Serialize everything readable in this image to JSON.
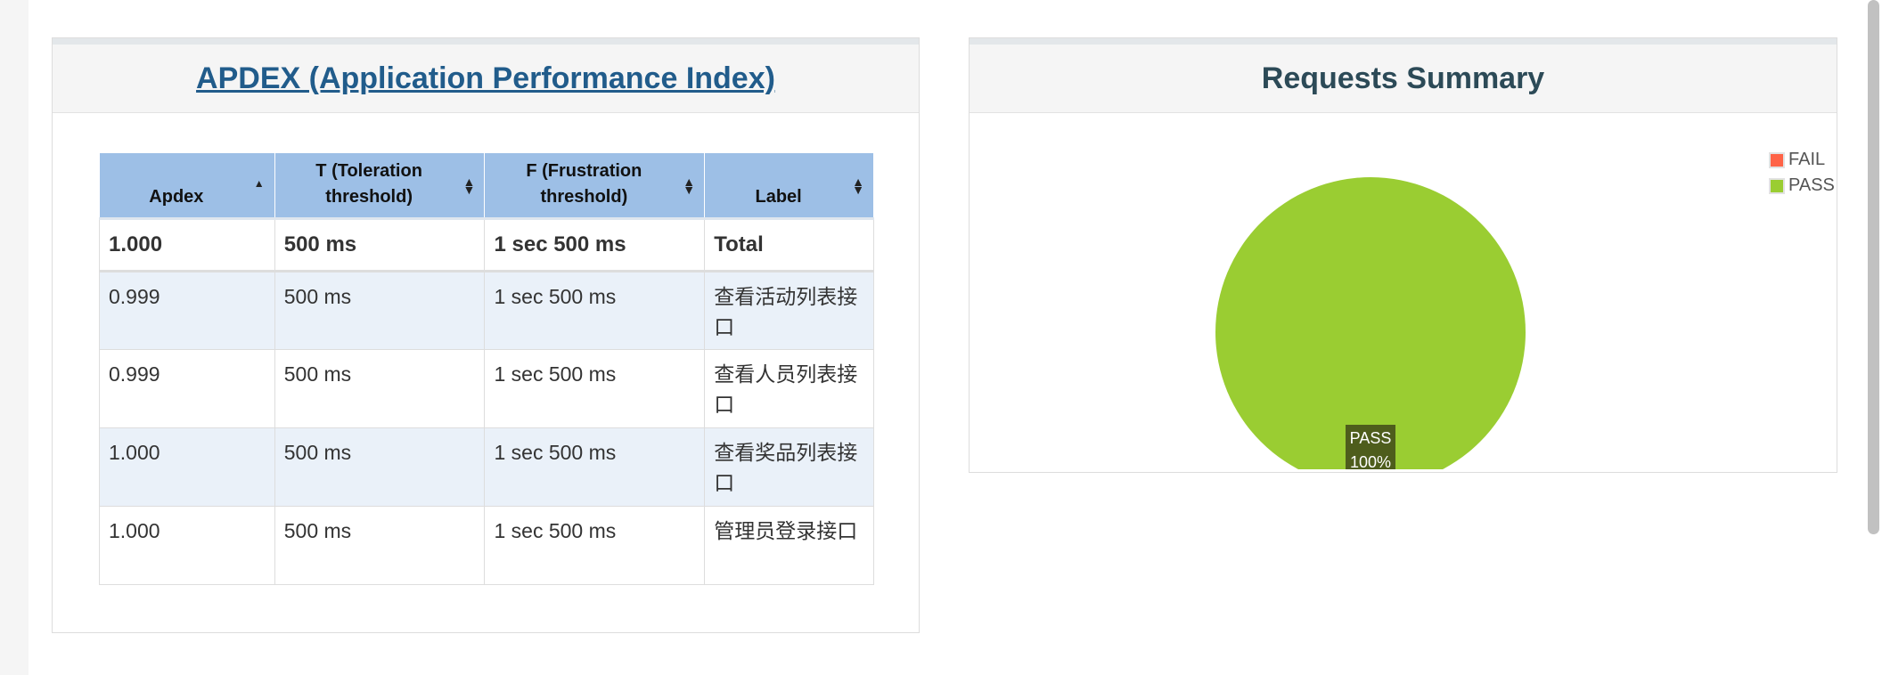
{
  "apdex": {
    "title": "APDEX (Application Performance Index)",
    "columns": [
      {
        "label": "Apdex",
        "sort": "▲"
      },
      {
        "label": "T (Toleration threshold)",
        "sort": "▲▼"
      },
      {
        "label": "F (Frustration threshold)",
        "sort": "▲▼"
      },
      {
        "label": "Label",
        "sort": "▲▼"
      }
    ],
    "total": {
      "apdex": "1.000",
      "t": "500 ms",
      "f": "1 sec 500 ms",
      "label": "Total"
    },
    "rows": [
      {
        "apdex": "0.999",
        "t": "500 ms",
        "f": "1 sec 500 ms",
        "label": "查看活动列表接口"
      },
      {
        "apdex": "0.999",
        "t": "500 ms",
        "f": "1 sec 500 ms",
        "label": "查看人员列表接口"
      },
      {
        "apdex": "1.000",
        "t": "500 ms",
        "f": "1 sec 500 ms",
        "label": "查看奖品列表接口"
      },
      {
        "apdex": "1.000",
        "t": "500 ms",
        "f": "1 sec 500 ms",
        "label": "管理员登录接口"
      }
    ]
  },
  "summary": {
    "title": "Requests Summary"
  },
  "chart_data": {
    "type": "pie",
    "title": "Requests Summary",
    "categories": [
      "FAIL",
      "PASS"
    ],
    "values": [
      0,
      100
    ],
    "colors": [
      "#ff6347",
      "#9acd32"
    ],
    "data_labels": [
      {
        "name": "PASS",
        "value": "100%"
      }
    ],
    "legend_position": "top-right"
  }
}
